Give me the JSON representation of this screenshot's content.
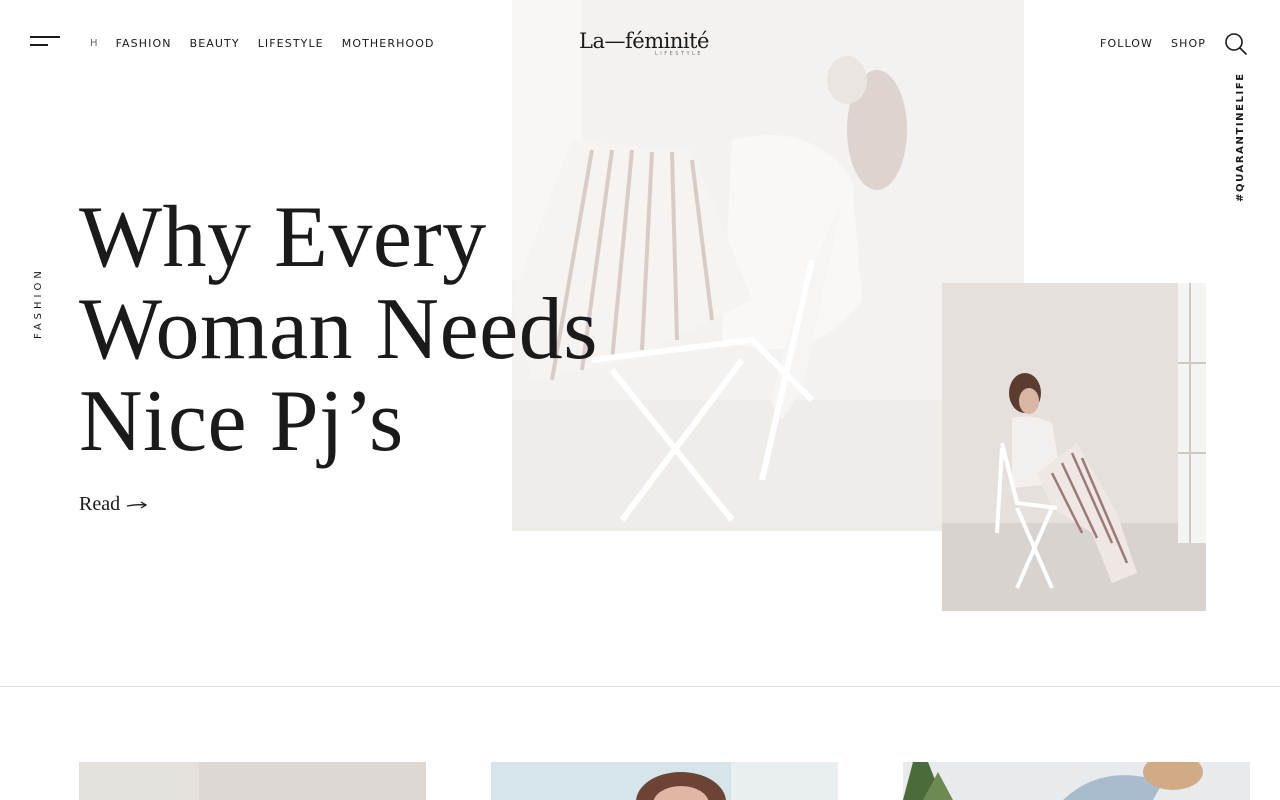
{
  "header": {
    "nav_items": [
      {
        "label": "H"
      },
      {
        "label": "FASHION"
      },
      {
        "label": "BEAUTY"
      },
      {
        "label": "LIFESTYLE"
      },
      {
        "label": "MOTHERHOOD"
      }
    ],
    "logo": {
      "main": "La—féminité",
      "sub": "LIFESTYLE"
    },
    "right_nav": [
      {
        "label": "FOLLOW"
      },
      {
        "label": "SHOP"
      }
    ],
    "icons": [
      "menu-icon",
      "search-icon"
    ]
  },
  "hero": {
    "category": "FASHION",
    "title": "Why Every Woman Needs Nice Pj’s",
    "read_label": "Read",
    "hashtag": "#QUARANTINELIFE"
  },
  "colors": {
    "text": "#1a1a1a",
    "background": "#ffffff",
    "divider": "#dedede"
  }
}
